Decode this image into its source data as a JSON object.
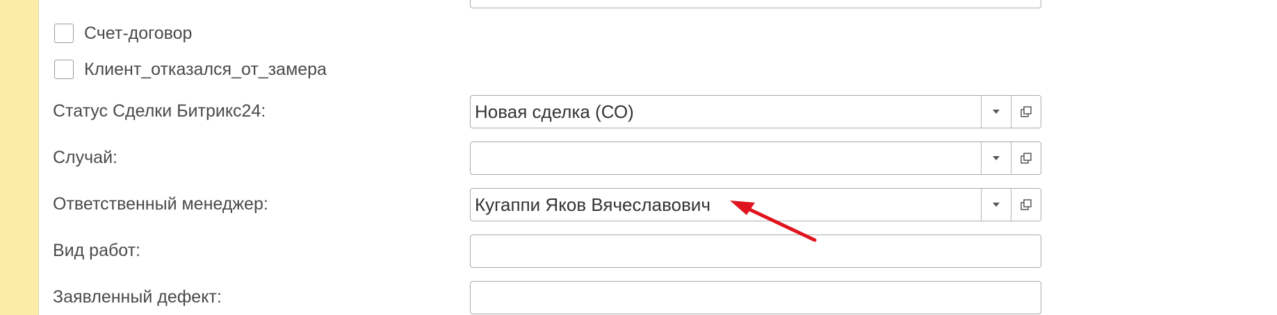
{
  "checkboxes": [
    {
      "label": "Счет-договор",
      "checked": false
    },
    {
      "label": "Клиент_отказался_от_замера",
      "checked": false
    }
  ],
  "fields": {
    "deal_status": {
      "label": "Статус Сделки Битрикс24:",
      "value": "Новая сделка (СО)"
    },
    "case": {
      "label": "Случай:",
      "value": ""
    },
    "manager": {
      "label": "Ответственный менеджер:",
      "value": "Кугаппи Яков Вячеславович"
    },
    "work_type": {
      "label": "Вид работ:",
      "value": ""
    },
    "defect": {
      "label": "Заявленный дефект:",
      "value": ""
    }
  },
  "icons": {
    "dropdown": "chevron-down-icon",
    "open": "open-form-icon"
  },
  "colors": {
    "side_strip": "#fbeda5",
    "annotation_arrow": "#e0141e"
  }
}
